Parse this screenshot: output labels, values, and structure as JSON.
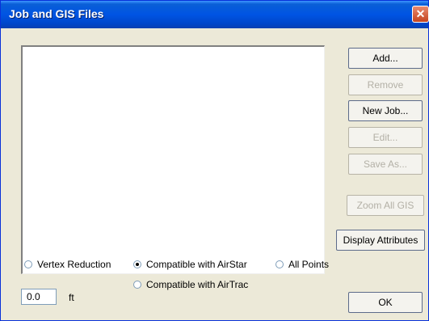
{
  "window": {
    "title": "Job and GIS Files",
    "close_label": "✕"
  },
  "buttons": {
    "add": "Add...",
    "remove": "Remove",
    "new_job": "New Job...",
    "edit": "Edit...",
    "save_as": "Save As...",
    "zoom_all_gis": "Zoom All GIS",
    "display_attributes": "Display Attributes",
    "ok": "OK"
  },
  "radios": {
    "vertex_reduction": "Vertex Reduction",
    "compatible_airstar": "Compatible with AirStar",
    "all_points": "All Points",
    "compatible_airtrac": "Compatible with AirTrac"
  },
  "tolerance": {
    "value": "0.0",
    "unit": "ft"
  }
}
